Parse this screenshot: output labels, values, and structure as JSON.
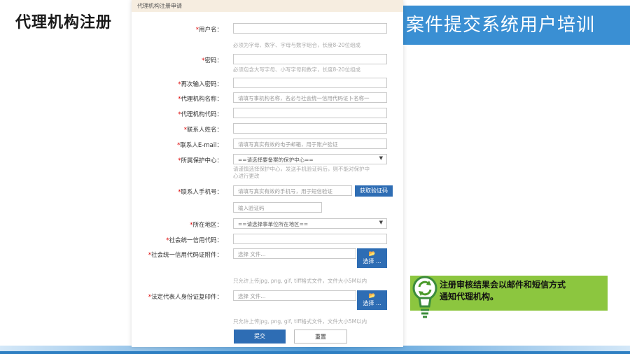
{
  "slide": {
    "left_title": "代理机构注册",
    "right_banner": "案件提交系统用户培训",
    "notice": [
      "注册审核结果会以邮件和短信方式",
      "通知代理机构。"
    ]
  },
  "form": {
    "header": "代理机构注册申请",
    "fields": [
      {
        "label": "用户名：",
        "value": ""
      },
      {
        "label": "密码：",
        "value": ""
      },
      {
        "label": "再次输入密码：",
        "value": ""
      },
      {
        "label": "代理机构名称：",
        "placeholder": "请填写事机构名称，名必与社会统一信用代码证卜名称一"
      },
      {
        "label": "代理机构代码：",
        "value": ""
      },
      {
        "label": "联系人姓名：",
        "value": ""
      },
      {
        "label": "联系人E-mail：",
        "placeholder": "请填写真实有效的电子邮箱，用于账户验证"
      },
      {
        "label": "所属保护中心：",
        "selected": "==请选择要备案的保护中心=="
      },
      {
        "label": "联系人手机号：",
        "placeholder": "请填写真实有效的手机号，用于短信验证"
      },
      {
        "label": "所在地区：",
        "selected": "==请选择事单位所在地区=="
      },
      {
        "label": "社会统一信用代码：",
        "value": ""
      },
      {
        "label": "社会统一信用代码证附件：",
        "file_placeholder": "选择 文件..."
      },
      {
        "label": "法定代表人身份证复印件：",
        "file_placeholder": "选择 文件..."
      }
    ],
    "hints": {
      "username": "必须为字母、数字、字母与数字组合，长度8-20位组成",
      "password": "必须包含大写字母、小写字母和数字，长度8-20位组成",
      "center_1": "请谨慎选择保护中心，发送手机验证码后，则不能对保护中",
      "center_2": "心进行更改",
      "upload_1": "只允许上传jpg, png, gif, tiff格式文件，文件大小5M以内",
      "upload_2": "只允许上传jpg, png, gif, tiff格式文件，文件大小5M以内"
    },
    "verify_code_placeholder": "输入验证码",
    "get_code_button": "获取验证码",
    "browse_button": "选择 ...",
    "submit_button": "提交",
    "reset_button": "重置"
  }
}
